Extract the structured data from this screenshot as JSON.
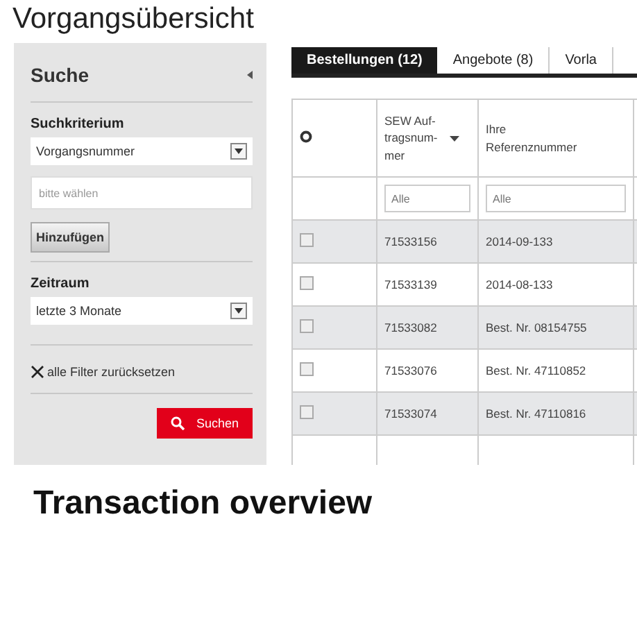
{
  "page_title": "Vorgangsübersicht",
  "search_panel": {
    "title": "Suche",
    "criterion_label": "Suchkriterium",
    "criterion_value": "Vorgangsnummer",
    "input_placeholder": "bitte wählen",
    "add_button": "Hinzufügen",
    "period_label": "Zeitraum",
    "period_value": "letzte 3 Monate",
    "reset_link": "alle Filter zurücksetzen",
    "search_button": "Suchen"
  },
  "tabs": [
    {
      "label": "Bestellungen (12)",
      "selected": true
    },
    {
      "label": "Angebote (8)",
      "selected": false
    },
    {
      "label": "Vorla",
      "selected": false
    }
  ],
  "table": {
    "columns": [
      {
        "label": "SEW Auf-tragsnum-mer",
        "sorted": true
      },
      {
        "label": "Ihre Referenznummer",
        "sorted": false
      }
    ],
    "filter_placeholders": [
      "Alle",
      "Alle"
    ],
    "rows": [
      {
        "checked": false,
        "cells": [
          "71533156",
          "2014-09-133"
        ]
      },
      {
        "checked": false,
        "cells": [
          "71533139",
          "2014-08-133"
        ]
      },
      {
        "checked": false,
        "cells": [
          "71533082",
          "Best. Nr. 08154755"
        ]
      },
      {
        "checked": false,
        "cells": [
          "71533076",
          "Best. Nr. 47110852"
        ]
      },
      {
        "checked": false,
        "cells": [
          "71533074",
          "Best. Nr. 47110816"
        ]
      }
    ]
  },
  "caption": "Transaction overview"
}
